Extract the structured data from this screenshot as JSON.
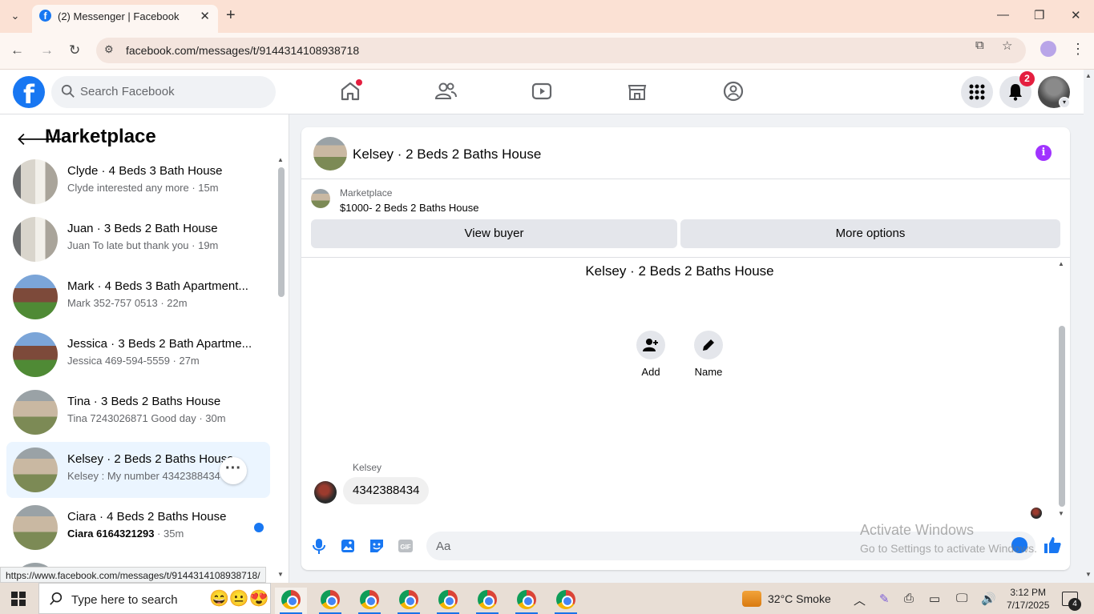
{
  "browser": {
    "tab_title": "(2) Messenger | Facebook",
    "url": "facebook.com/messages/t/9144314108938718",
    "status_url": "https://www.facebook.com/messages/t/9144314108938718/"
  },
  "fb_header": {
    "search_placeholder": "Search Facebook",
    "notification_count": "2",
    "brand_color": "#1877f2"
  },
  "sidebar": {
    "title": "Marketplace",
    "conversations": [
      {
        "name": "Clyde · 4 Beds 3 Bath House",
        "subtitle": "Clyde interested any more · 15m",
        "thumb": "room"
      },
      {
        "name": "Juan · 3 Beds 2 Bath House",
        "subtitle": "Juan To late but thank you · 19m",
        "thumb": "room"
      },
      {
        "name": "Mark · 4 Beds 3 Bath Apartment...",
        "subtitle": "Mark 352-757 0513 · 22m",
        "thumb": "apartment"
      },
      {
        "name": "Jessica · 3 Beds 2 Bath Apartme...",
        "subtitle": "Jessica 469-594-5559 · 27m",
        "thumb": "apartment"
      },
      {
        "name": "Tina · 3 Beds 2 Baths House",
        "subtitle": "Tina 7243026871 Good day · 30m",
        "thumb": "house"
      },
      {
        "name": "Kelsey · 2 Beds 2 Baths House",
        "subtitle": "Kelsey : My number 4342388434 ·",
        "thumb": "house",
        "active": true
      },
      {
        "name": "Ciara · 4 Beds 2 Baths House",
        "subtitle_bold": "Ciara 6164321293",
        "subtitle_time": " · 35m",
        "thumb": "house",
        "unread": true
      }
    ]
  },
  "chat": {
    "title": "Kelsey · 2 Beds 2 Baths House",
    "marketplace_label": "Marketplace",
    "listing": "$1000- 2 Beds 2 Baths House",
    "view_buyer_label": "View buyer",
    "more_options_label": "More options",
    "conversation_title": "Kelsey · 2 Beds 2 Baths House",
    "add_label": "Add",
    "name_label": "Name",
    "sender": "Kelsey",
    "message": "4342388434",
    "composer_placeholder": "Aa"
  },
  "watermark": {
    "line1": "Activate Windows",
    "line2": "Go to Settings to activate Windows."
  },
  "taskbar": {
    "search_placeholder": "Type here to search",
    "weather": "32°C  Smoke",
    "time": "3:12 PM",
    "date": "7/17/2025",
    "notification_count": "4"
  }
}
